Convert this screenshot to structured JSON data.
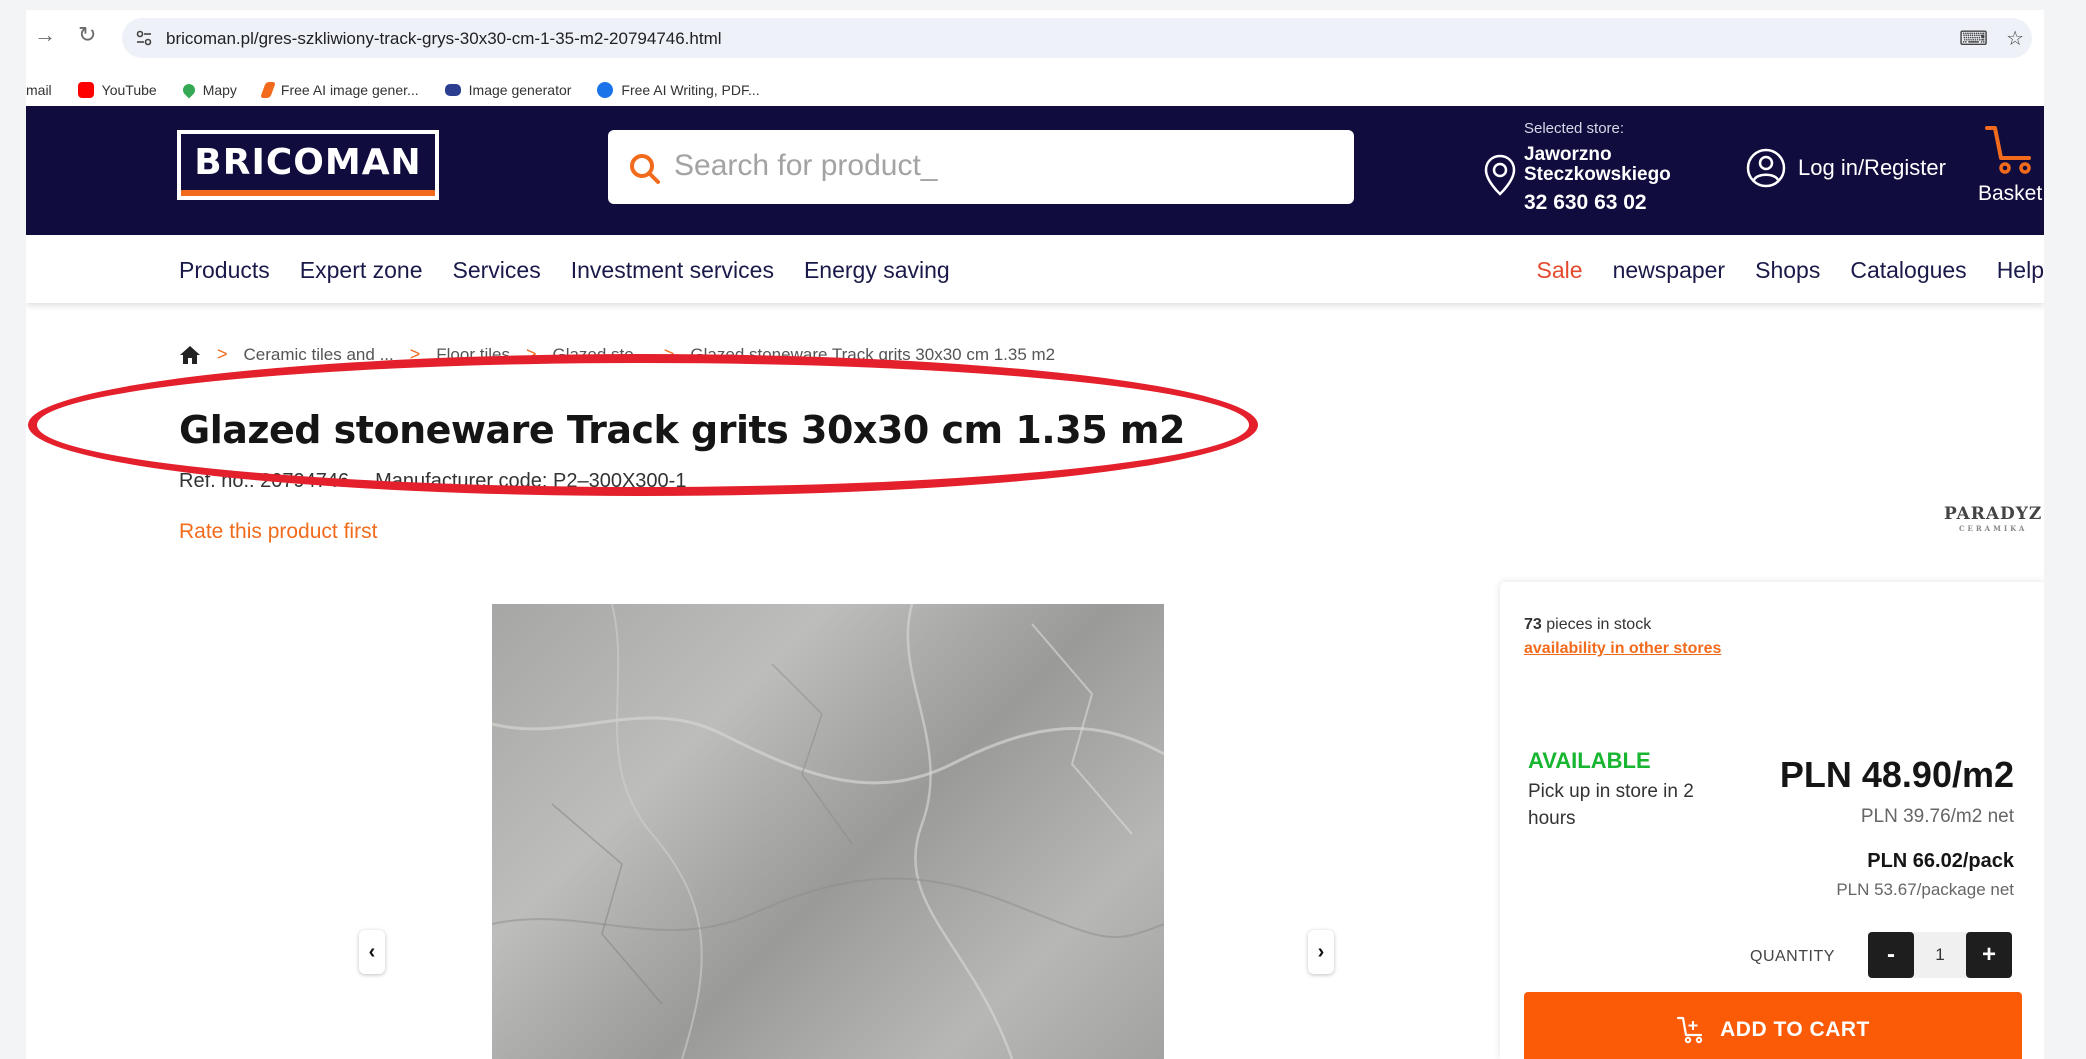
{
  "browser": {
    "url": "bricoman.pl/gres-szkliwiony-track-grys-30x30-cm-1-35-m2-20794746.html",
    "bookmarks": [
      {
        "label": "mail",
        "color": ""
      },
      {
        "label": "YouTube",
        "color": "#ff0000"
      },
      {
        "label": "Mapy",
        "color": "#34a853"
      },
      {
        "label": "Free AI image gener...",
        "color": "#f26b1d"
      },
      {
        "label": "Image generator",
        "color": "#2c3e8f"
      },
      {
        "label": "Free AI Writing, PDF...",
        "color": "#1a73e8"
      }
    ]
  },
  "header": {
    "logo_text": "BRICOMAN",
    "search_placeholder": "Search for product_",
    "store_label": "Selected store:",
    "store_name_1": "Jaworzno",
    "store_name_2": "Steczkowskiego",
    "store_phone": "32 630 63 02",
    "login_label": "Log in/Register",
    "basket_label": "Basket"
  },
  "nav": {
    "left": [
      "Products",
      "Expert zone",
      "Services",
      "Investment services",
      "Energy saving"
    ],
    "right": [
      "Sale",
      "newspaper",
      "Shops",
      "Catalogues",
      "Help"
    ]
  },
  "breadcrumb": {
    "items": [
      "Ceramic tiles and ...",
      "Floor tiles",
      "Glazed sto...",
      "Glazed stoneware Track grits 30x30 cm 1.35 m2"
    ]
  },
  "product": {
    "title": "Glazed stoneware Track grits 30x30 cm 1.35 m2",
    "ref_no": "Ref. no.: 20794746",
    "manufacturer_code": "Manufacturer code: P2–300X300-1",
    "rate_label": "Rate this product first",
    "brand": "PARADYZ",
    "brand_sub": "CERAMIKA"
  },
  "buybox": {
    "stock_count": "73",
    "stock_text": "pieces in stock",
    "other_stores": "availability in other stores",
    "availability": "AVAILABLE",
    "pickup": "Pick up in store in 2 hours",
    "price_m2": "PLN 48.90/m2",
    "price_m2_net": "PLN 39.76/m2 net",
    "price_pack": "PLN 66.02/pack",
    "price_pack_net": "PLN 53.67/package net",
    "quantity_label": "QUANTITY",
    "quantity_value": "1",
    "minus": "-",
    "plus": "+",
    "add_to_cart": "ADD TO CART"
  },
  "colors": {
    "brand_navy": "#100c3d",
    "brand_orange": "#f26b1d",
    "cta_orange": "#fb5a07",
    "available_green": "#17b530",
    "annotation_red": "#e3202b"
  }
}
